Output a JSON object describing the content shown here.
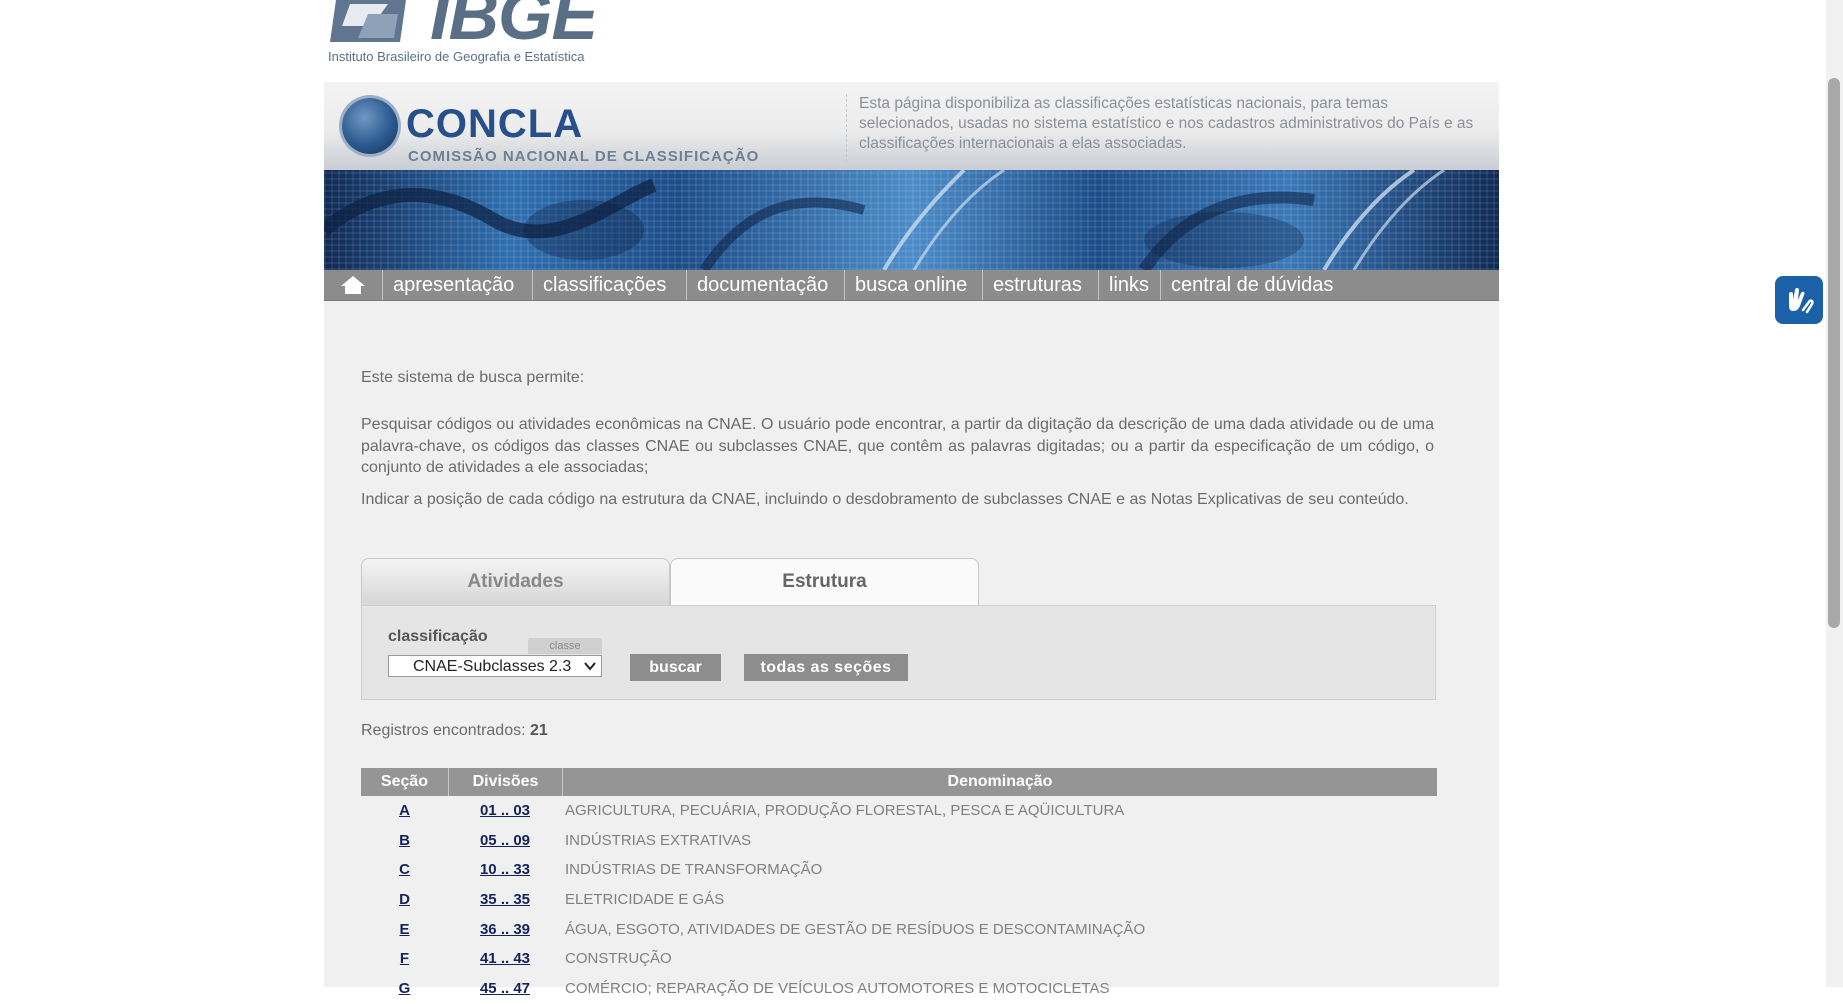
{
  "ibge": {
    "word": "IBGE",
    "subtitle": "Instituto Brasileiro de Geografia e Estatística"
  },
  "concla": {
    "title": "CONCLA",
    "subtitle": "COMISSÃO NACIONAL DE CLASSIFICAÇÃO",
    "description": "Esta página disponibiliza as classificações estatísticas nacionais, para temas selecionados, usadas no sistema estatístico e nos cadastros administrativos do País e as classificações internacionais a elas associadas."
  },
  "nav": {
    "home_icon": "home-icon",
    "items": [
      "apresentação",
      "classificações",
      "documentação",
      "busca online",
      "estruturas",
      "links",
      "central de dúvidas"
    ]
  },
  "intro": {
    "line1": "Este sistema de busca permite:",
    "line2": "Pesquisar códigos ou atividades econômicas na CNAE. O usuário pode encontrar, a partir da digitação da descrição de uma dada atividade ou de uma palavra-chave, os códigos das classes CNAE ou subclasses CNAE, que contêm as palavras digitadas; ou a partir da especificação de um código, o conjunto de atividades a ele associadas;",
    "line3": "Indicar a posição de cada código na estrutura da CNAE, incluindo o desdobramento de subclasses CNAE e as Notas Explicativas de seu conteúdo."
  },
  "tabs": {
    "atividades": "Atividades",
    "estrutura": "Estrutura",
    "active": "Estrutura"
  },
  "form": {
    "label": "classificação",
    "tag": "classe",
    "selected": "CNAE-Subclasses 2.3",
    "buscar": "buscar",
    "todas": "todas as seções"
  },
  "registros": {
    "label": "Registros encontrados:",
    "count": "21"
  },
  "table": {
    "headers": [
      "Seção",
      "Divisões",
      "Denominação"
    ],
    "rows": [
      {
        "secao": "A",
        "divisoes": "01 .. 03",
        "denominacao": "AGRICULTURA, PECUÁRIA, PRODUÇÃO FLORESTAL, PESCA E AQÜICULTURA"
      },
      {
        "secao": "B",
        "divisoes": "05 .. 09",
        "denominacao": "INDÚSTRIAS EXTRATIVAS"
      },
      {
        "secao": "C",
        "divisoes": "10 .. 33",
        "denominacao": "INDÚSTRIAS DE TRANSFORMAÇÃO"
      },
      {
        "secao": "D",
        "divisoes": "35 .. 35",
        "denominacao": "ELETRICIDADE E GÁS"
      },
      {
        "secao": "E",
        "divisoes": "36 .. 39",
        "denominacao": "ÁGUA, ESGOTO, ATIVIDADES DE GESTÃO DE RESÍDUOS E DESCONTAMINAÇÃO"
      },
      {
        "secao": "F",
        "divisoes": "41 .. 43",
        "denominacao": "CONSTRUÇÃO"
      },
      {
        "secao": "G",
        "divisoes": "45 .. 47",
        "denominacao": "COMÉRCIO; REPARAÇÃO DE VEÍCULOS AUTOMOTORES E MOTOCICLETAS"
      }
    ]
  },
  "widgets": {
    "vlibras_icon": "sign-language-hands-icon"
  },
  "colors": {
    "nav_bg": "#8c8c8c",
    "link": "#15235a",
    "brand_blue": "#27508a",
    "vlibras": "#1a61a8"
  }
}
